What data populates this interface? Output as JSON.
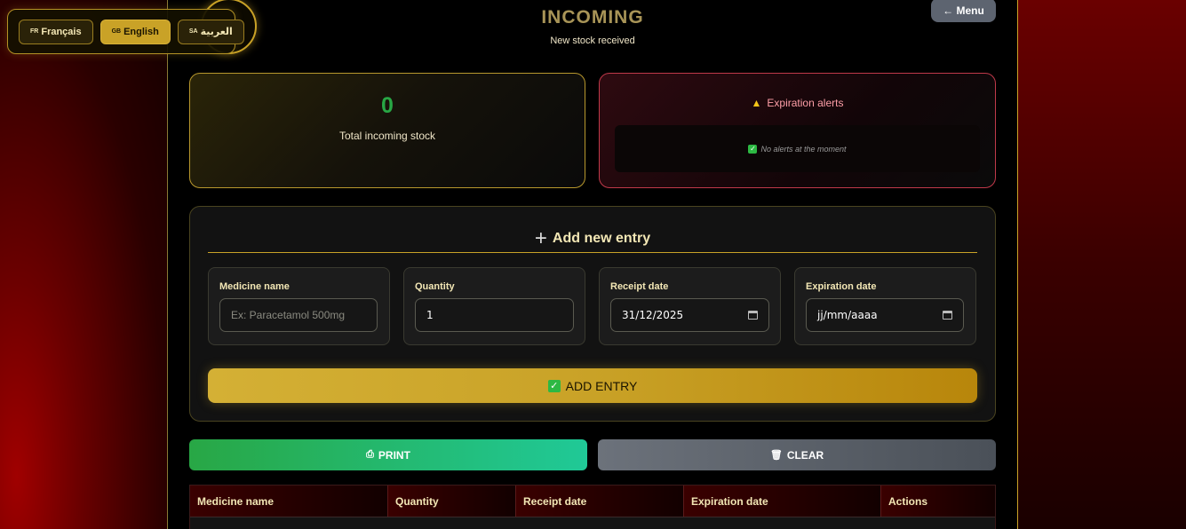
{
  "languages": [
    {
      "flag": "FR",
      "label": "Français",
      "active": false
    },
    {
      "flag": "GB",
      "label": "English",
      "active": true
    },
    {
      "flag": "SA",
      "label": "العربية",
      "active": false
    }
  ],
  "header": {
    "title": "INCOMING",
    "subtitle": "New stock received",
    "menu_label": "← Menu"
  },
  "stats": {
    "total_value": "0",
    "total_label": "Total incoming stock"
  },
  "alerts": {
    "title": "Expiration alerts",
    "empty_message": "No alerts at the moment"
  },
  "form": {
    "title": "Add new entry",
    "fields": [
      {
        "label": "Medicine name",
        "value": "",
        "placeholder": "Ex: Paracetamol 500mg"
      },
      {
        "label": "Quantity",
        "value": "1",
        "placeholder": ""
      },
      {
        "label": "Receipt date",
        "value": "31/12/2025",
        "placeholder": ""
      },
      {
        "label": "Expiration date",
        "value": "",
        "placeholder": "jj/mm/aaaa"
      }
    ],
    "submit_label": "ADD ENTRY"
  },
  "actions": {
    "print_label": "PRINT",
    "clear_label": "CLEAR"
  },
  "table": {
    "columns": [
      "Medicine name",
      "Quantity",
      "Receipt date",
      "Expiration date",
      "Actions"
    ]
  },
  "colors": {
    "accent_gold": "#c9a227",
    "success_green": "#28a745",
    "alert_red": "#c0394a"
  }
}
